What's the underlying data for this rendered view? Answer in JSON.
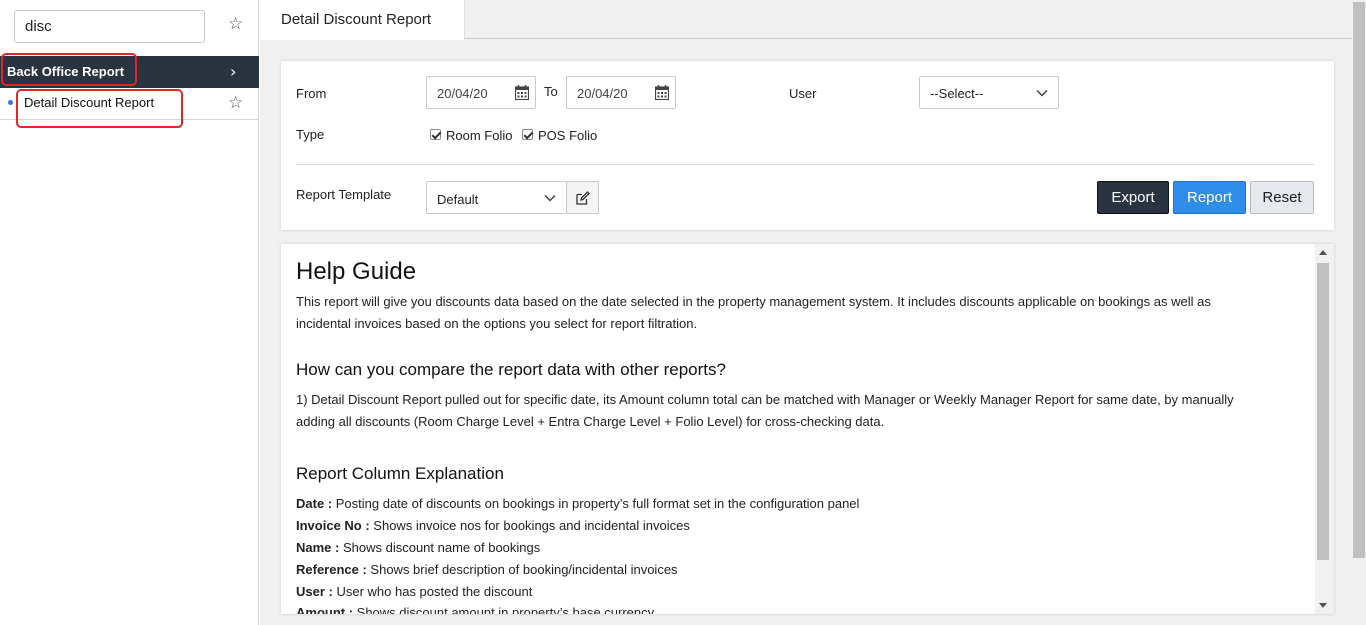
{
  "sidebar": {
    "search_value": "disc",
    "group_label": "Back Office Report",
    "item_label": "Detail Discount Report"
  },
  "tab": {
    "title": "Detail Discount Report"
  },
  "filters": {
    "from_label": "From",
    "from_value": "20/04/20",
    "to_label": "To",
    "to_value": "20/04/20",
    "user_label": "User",
    "user_value": "--Select--",
    "type_label": "Type",
    "room_folio_label": "Room Folio",
    "room_folio_checked": true,
    "pos_folio_label": "POS Folio",
    "pos_folio_checked": true,
    "template_label": "Report Template",
    "template_value": "Default"
  },
  "buttons": {
    "export": "Export",
    "report": "Report",
    "reset": "Reset"
  },
  "help": {
    "title": "Help Guide",
    "intro_line1": "This report will give you discounts data based on the date selected in the property management system. It includes discounts applicable on bookings as well as",
    "intro_line2": "incidental invoices based on the options you select for report filtration.",
    "compare_heading": "How can you compare the report data with other reports?",
    "compare_line1": "1) Detail Discount Report pulled out for specific date, its Amount column total can be matched with Manager or Weekly Manager Report for same date, by manually",
    "compare_line2": "adding all discounts (Room Charge Level + Entra Charge Level + Folio Level) for cross-checking data.",
    "columns_heading": "Report Column Explanation",
    "columns": [
      {
        "term": "Date :",
        "desc": " Posting date of discounts on bookings in property’s full format set in the configuration panel"
      },
      {
        "term": "Invoice No :",
        "desc": " Shows invoice nos for bookings and incidental invoices"
      },
      {
        "term": "Name :",
        "desc": " Shows discount name of bookings"
      },
      {
        "term": "Reference :",
        "desc": " Shows brief description of booking/incidental invoices"
      },
      {
        "term": "User :",
        "desc": " User who has posted the discount"
      },
      {
        "term": "Amount  :",
        "desc": " Shows discount amount in property’s base currency"
      }
    ]
  },
  "colors": {
    "sidebar_header": "#2a3441",
    "highlight": "#e0262b",
    "export_button": "#2a3441",
    "report_button": "#2f8ce8",
    "active_dot": "#2d7de0"
  },
  "icons": {
    "favorite": "star-outline",
    "expand": "chevron-right",
    "date_picker": "calendar",
    "dropdown": "chevron-down",
    "edit_template": "edit-pencil"
  }
}
